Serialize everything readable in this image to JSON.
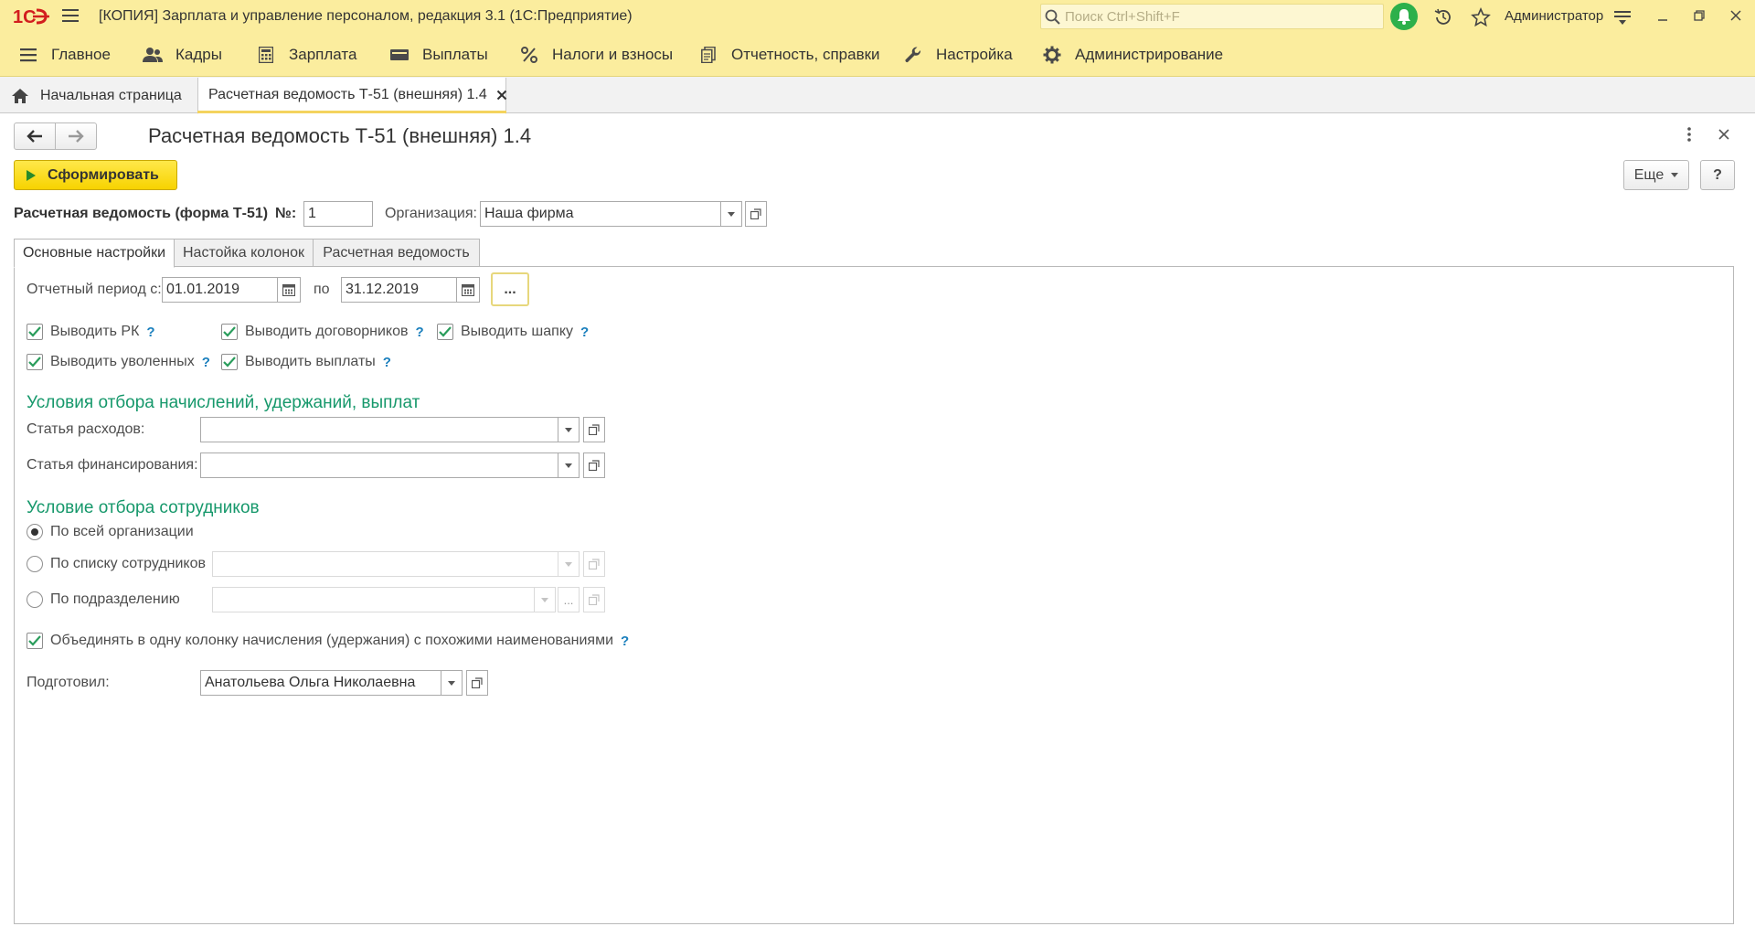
{
  "titlebar": {
    "title": "[КОПИЯ] Зарплата и управление персоналом, редакция 3.1  (1С:Предприятие)",
    "search_placeholder": "Поиск Ctrl+Shift+F",
    "user": "Администратор"
  },
  "menu": {
    "items": [
      {
        "label": "Главное",
        "icon": "hamburger-icon"
      },
      {
        "label": "Кадры",
        "icon": "people-icon"
      },
      {
        "label": "Зарплата",
        "icon": "calculator-icon"
      },
      {
        "label": "Выплаты",
        "icon": "wallet-icon"
      },
      {
        "label": "Налоги и взносы",
        "icon": "percent-icon"
      },
      {
        "label": "Отчетность, справки",
        "icon": "documents-icon"
      },
      {
        "label": "Настройка",
        "icon": "wrench-icon"
      },
      {
        "label": "Администрирование",
        "icon": "gear-icon"
      }
    ]
  },
  "tabs": {
    "home": "Начальная страница",
    "active": "Расчетная ведомость Т-51 (внешняя) 1.4"
  },
  "form": {
    "title": "Расчетная ведомость Т-51 (внешняя) 1.4",
    "generate_button": "Сформировать",
    "more_button": "Еще",
    "help_button": "?",
    "header_label": "Расчетная ведомость (форма Т-51)",
    "number_label": "№:",
    "number_value": "1",
    "org_label": "Организация:",
    "org_value": "Наша фирма"
  },
  "form_tabs": [
    "Основные настройки",
    "Настойка колонок",
    "Расчетная ведомость"
  ],
  "settings": {
    "period_label": "Отчетный период с:",
    "period_from": "01.01.2019",
    "period_to_label": "по",
    "period_to": "31.12.2019",
    "period_button": "...",
    "checkboxes": [
      {
        "label": "Выводить РК",
        "checked": true
      },
      {
        "label": "Выводить договорников",
        "checked": true
      },
      {
        "label": "Выводить шапку",
        "checked": true
      },
      {
        "label": "Выводить уволенных",
        "checked": true
      },
      {
        "label": "Выводить выплаты",
        "checked": true
      }
    ],
    "help_mark": "?",
    "section_accruals": "Условия отбора начислений, удержаний, выплат",
    "expense_label": "Статья расходов:",
    "financing_label": "Статья финансирования:",
    "section_employees": "Условие отбора сотрудников",
    "radios": [
      {
        "label": "По всей организации",
        "selected": true
      },
      {
        "label": "По списку сотрудников",
        "selected": false
      },
      {
        "label": "По подразделению",
        "selected": false
      }
    ],
    "dept_button": "...",
    "merge_label": "Объединять в одну колонку начисления (удержания) с похожими наименованиями",
    "merge_checked": true,
    "prepared_label": "Подготовил:",
    "prepared_value": "Анатольева Ольга Николаевна"
  },
  "colors": {
    "titlebar_bg": "#fbed9e",
    "section_green": "#16986b",
    "help_blue": "#1a7fbd",
    "generate_yellow": "#f7d300"
  }
}
